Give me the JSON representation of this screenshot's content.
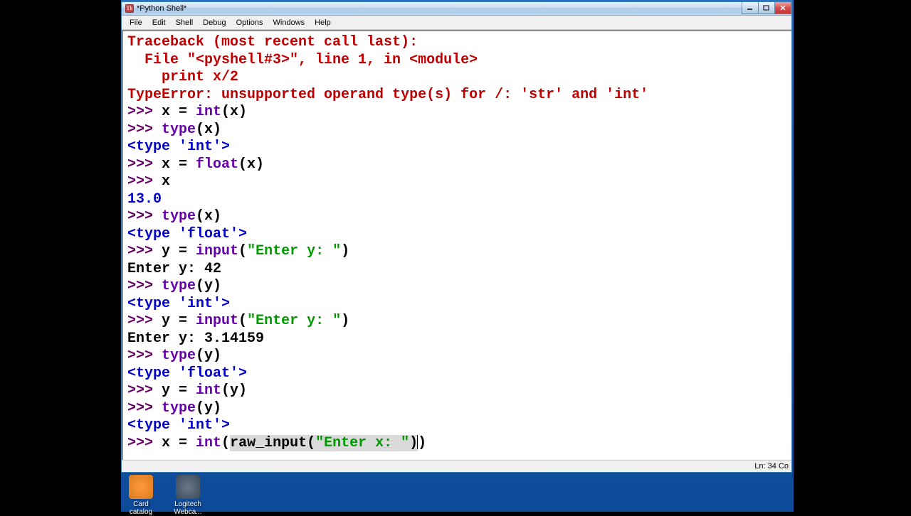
{
  "window": {
    "title": "*Python Shell*"
  },
  "menu": [
    "File",
    "Edit",
    "Shell",
    "Debug",
    "Options",
    "Windows",
    "Help"
  ],
  "status": "Ln: 34 Co",
  "desktop_icons": [
    {
      "label": "Card catalog",
      "color": "linear-gradient(135deg,#ffb347,#ffcc33)"
    },
    {
      "label": "Logitech Webca...",
      "color": "#4a5a6a"
    }
  ],
  "shell": {
    "traceback_l1": "Traceback (most recent call last):",
    "traceback_l2": "  File \"<pyshell#3>\", line 1, in <module>",
    "traceback_l3": "    print x/2",
    "traceback_l4": "TypeError: unsupported operand type(s) for /: 'str' and 'int'",
    "p": ">>> ",
    "assign_x_int": "x = int(x)",
    "type_x": "type(x)",
    "out_type_int": "<type 'int'>",
    "assign_x_float": "x = float(x)",
    "x_alone": "x",
    "out_13": "13.0",
    "out_type_float": "<type 'float'>",
    "y_input": "y = input(\"Enter y: \")",
    "enter_y_42": "Enter y: 42",
    "type_y": "type(y)",
    "y_input2": "y = input(\"Enter y: \")",
    "enter_y_pi": "Enter y: 3.14159",
    "y_int": "y = int(y)",
    "x_rawinput_pre": "x = int(",
    "x_rawinput_mid": "raw_input(\"Enter x: \")",
    "x_rawinput_post": ")",
    "input_word": "input",
    "int_word": "int",
    "float_word": "float",
    "type_word": "type",
    "enter_y_str": "\"Enter y: \"",
    "enter_x_str": "\"Enter x: \"",
    "rawinput_word": "raw_input",
    "x_eq": "x = ",
    "y_eq": "y = ",
    "paren_x": "(x)",
    "paren_y": "(y)",
    "open_p": "(",
    "close_p": ")"
  }
}
